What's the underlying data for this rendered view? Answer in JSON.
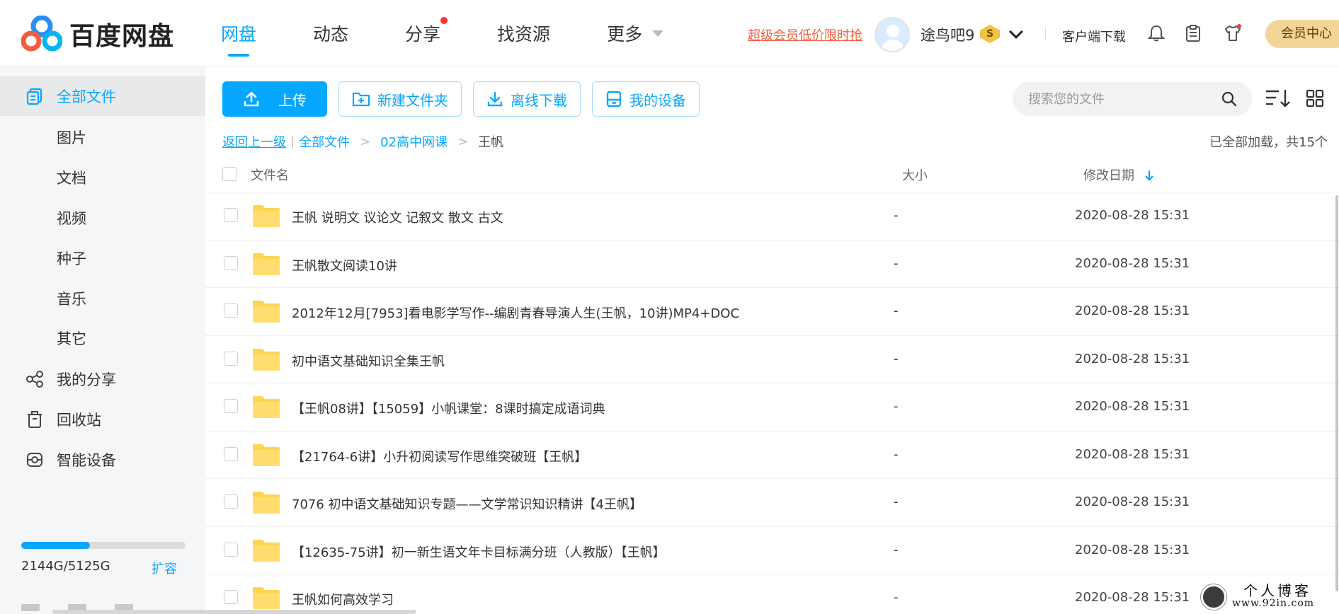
{
  "header": {
    "logo_text": "百度网盘",
    "nav": [
      {
        "label": "网盘",
        "active": true
      },
      {
        "label": "动态"
      },
      {
        "label": "分享",
        "dot": true
      },
      {
        "label": "找资源"
      },
      {
        "label": "更多",
        "caret": true
      }
    ],
    "promo_link": "超级会员低价限时抢",
    "username": "途鸟吧9",
    "vip_letter": "S",
    "client_download": "客户端下载",
    "member_center": "会员中心"
  },
  "sidebar": {
    "items": [
      {
        "label": "全部文件",
        "icon": "files-icon",
        "active": true
      },
      {
        "label": "图片"
      },
      {
        "label": "文档"
      },
      {
        "label": "视频"
      },
      {
        "label": "种子"
      },
      {
        "label": "音乐"
      },
      {
        "label": "其它"
      },
      {
        "label": "我的分享",
        "icon": "share-icon"
      },
      {
        "label": "回收站",
        "icon": "trash-icon"
      },
      {
        "label": "智能设备",
        "icon": "device-icon"
      }
    ],
    "quota_text": "2144G/5125G",
    "quota_fraction": 0.418,
    "expand_label": "扩容"
  },
  "toolbar": {
    "upload": "上传",
    "new_folder": "新建文件夹",
    "offline_download": "离线下载",
    "my_devices": "我的设备",
    "search_placeholder": "搜索您的文件"
  },
  "breadcrumb": {
    "back": "返回上一级",
    "all_files": "全部文件",
    "parent": "02高中网课",
    "current": "王帆"
  },
  "load_status": "已全部加载，共15个",
  "table": {
    "col_name": "文件名",
    "col_size": "大小",
    "col_date": "修改日期",
    "rows": [
      {
        "name": "王帆 说明文 议论文 记叙文 散文 古文",
        "size": "-",
        "date": "2020-08-28 15:31"
      },
      {
        "name": "王帆散文阅读10讲",
        "size": "-",
        "date": "2020-08-28 15:31"
      },
      {
        "name": "2012年12月[7953]看电影学写作--编剧青春导演人生(王帆，10讲)MP4+DOC",
        "size": "-",
        "date": "2020-08-28 15:31"
      },
      {
        "name": "初中语文基础知识全集王帆",
        "size": "-",
        "date": "2020-08-28 15:31"
      },
      {
        "name": "【王帆08讲】【15059】小帆课堂：8课时搞定成语词典",
        "size": "-",
        "date": "2020-08-28 15:31"
      },
      {
        "name": "【21764-6讲】小升初阅读写作思维突破班【王帆】",
        "size": "-",
        "date": "2020-08-28 15:31"
      },
      {
        "name": "7076 初中语文基础知识专题——文学常识知识精讲【4王帆】",
        "size": "-",
        "date": "2020-08-28 15:31"
      },
      {
        "name": "【12635-75讲】初一新生语文年卡目标满分班（人教版）【王帆】",
        "size": "-",
        "date": "2020-08-28 15:31"
      },
      {
        "name": "王帆如何高效学习",
        "size": "-",
        "date": "2020-08-28 15:31"
      }
    ]
  },
  "watermark": {
    "title": "个人博客",
    "url": "www.92in.com"
  },
  "colors": {
    "accent": "#06a7ff",
    "promo": "#f25d3d",
    "folder": "#ffd454",
    "member": "#f3d59a"
  }
}
